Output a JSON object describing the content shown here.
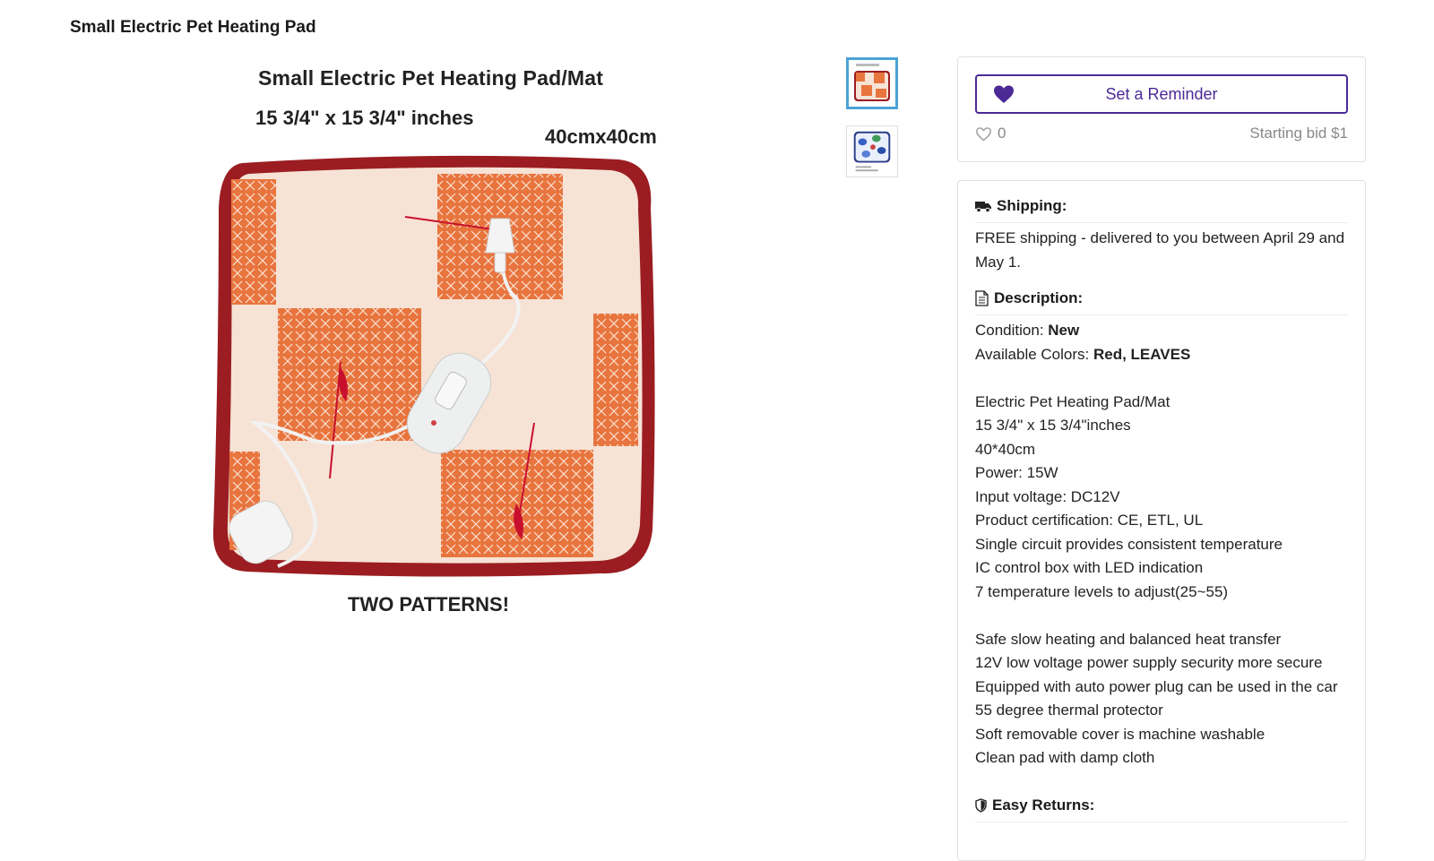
{
  "page": {
    "title": "Small Electric Pet Heating Pad"
  },
  "image": {
    "line1": "Small Electric Pet Heating Pad/Mat",
    "line2": "15 3/4\" x 15 3/4\" inches",
    "line3": "40cmx40cm",
    "line4": "TWO PATTERNS!"
  },
  "thumbnails": [
    {
      "name": "thumbnail-red-pattern",
      "active": true
    },
    {
      "name": "thumbnail-leaves-pattern",
      "active": false
    }
  ],
  "reminder": {
    "button_label": "Set a Reminder",
    "likes": "0",
    "starting_bid": "Starting bid $1"
  },
  "shipping": {
    "heading": "Shipping:",
    "text": "FREE shipping - delivered to you between April 29 and May 1."
  },
  "description": {
    "heading": "Description:",
    "condition_label": "Condition: ",
    "condition_value": "New",
    "colors_label": "Available Colors: ",
    "colors_value": "Red, LEAVES",
    "lines_a": [
      "Electric Pet Heating Pad/Mat",
      "15 3/4\" x 15 3/4\"inches",
      "40*40cm",
      "Power: 15W",
      "Input voltage: DC12V",
      "Product certification: CE, ETL, UL",
      "Single circuit provides consistent temperature",
      "IC control box with LED indication",
      "7 temperature levels to adjust(25~55)"
    ],
    "lines_b": [
      "Safe slow heating and balanced heat transfer",
      "12V low voltage power supply security more secure",
      "Equipped with auto power plug can be used in the car",
      "55 degree thermal protector",
      "Soft removable cover is machine washable",
      "Clean pad with damp cloth"
    ]
  },
  "returns": {
    "heading": "Easy Returns:"
  },
  "colors": {
    "accent": "#4b2a96",
    "thumb_active_border": "#4aa3d6",
    "pad_orange": "#e8743e",
    "pad_border": "#9b1d22",
    "pad_base": "#f6e3d6"
  }
}
